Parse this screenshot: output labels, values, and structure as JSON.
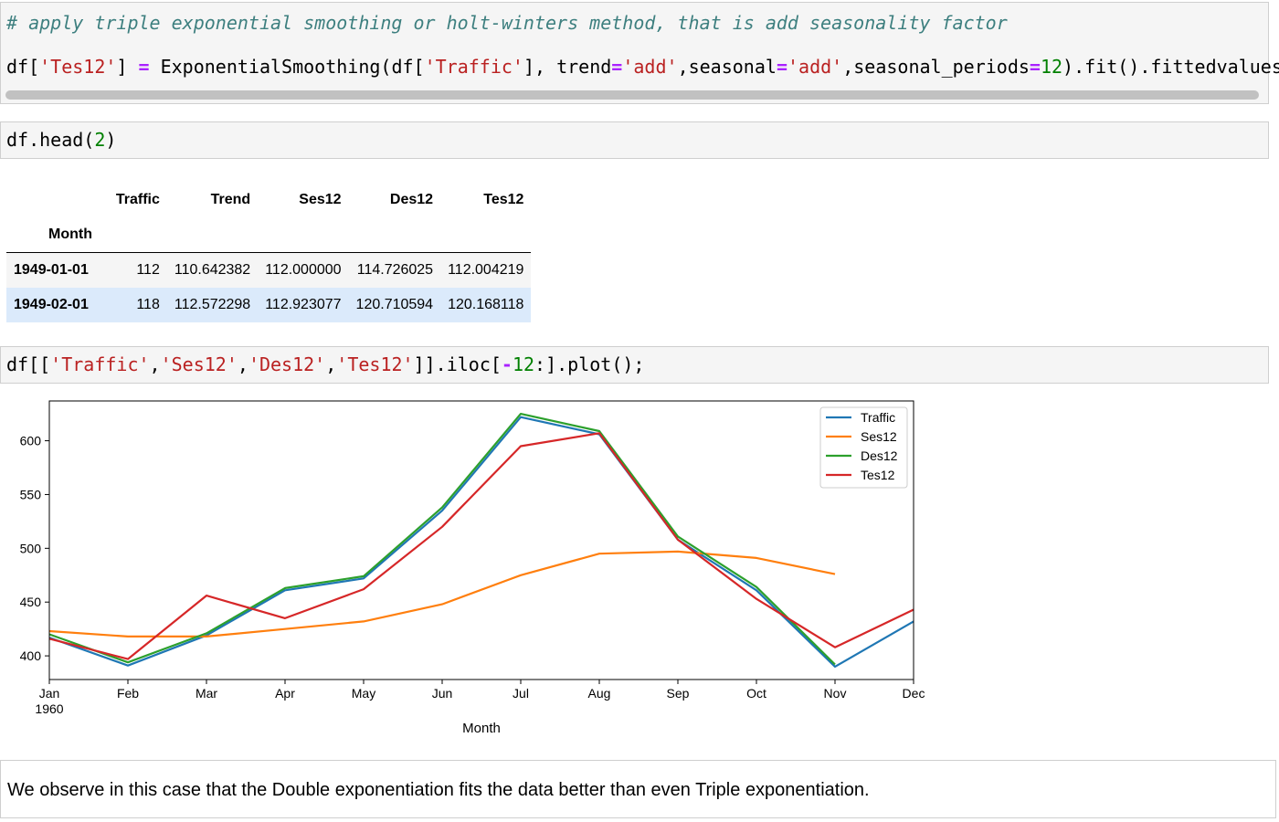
{
  "cells": {
    "code1": {
      "comment": "# apply triple exponential smoothing or holt-winters method, that is add seasonality factor",
      "tokens": [
        {
          "t": "df[",
          "c": ""
        },
        {
          "t": "'Tes12'",
          "c": "st"
        },
        {
          "t": "] ",
          "c": ""
        },
        {
          "t": "=",
          "c": "op"
        },
        {
          "t": " ExponentialSmoothing(df[",
          "c": ""
        },
        {
          "t": "'Traffic'",
          "c": "st"
        },
        {
          "t": "], trend",
          "c": ""
        },
        {
          "t": "=",
          "c": "op"
        },
        {
          "t": "'add'",
          "c": "st"
        },
        {
          "t": ",seasonal",
          "c": ""
        },
        {
          "t": "=",
          "c": "op"
        },
        {
          "t": "'add'",
          "c": "st"
        },
        {
          "t": ",seasonal_periods",
          "c": ""
        },
        {
          "t": "=",
          "c": "op"
        },
        {
          "t": "12",
          "c": "nu"
        },
        {
          "t": ").fit().fittedvalues",
          "c": ""
        }
      ]
    },
    "code2": {
      "tokens": [
        {
          "t": "df.head(",
          "c": ""
        },
        {
          "t": "2",
          "c": "nu"
        },
        {
          "t": ")",
          "c": ""
        }
      ]
    },
    "code3": {
      "tokens": [
        {
          "t": "df[[",
          "c": ""
        },
        {
          "t": "'Traffic'",
          "c": "st"
        },
        {
          "t": ",",
          "c": ""
        },
        {
          "t": "'Ses12'",
          "c": "st"
        },
        {
          "t": ",",
          "c": ""
        },
        {
          "t": "'Des12'",
          "c": "st"
        },
        {
          "t": ",",
          "c": ""
        },
        {
          "t": "'Tes12'",
          "c": "st"
        },
        {
          "t": "]].iloc[",
          "c": ""
        },
        {
          "t": "-",
          "c": "op"
        },
        {
          "t": "12",
          "c": "nu"
        },
        {
          "t": ":].plot();",
          "c": ""
        }
      ]
    },
    "markdown": "We observe in this case that the Double exponentiation fits the data better than even Triple exponentiation."
  },
  "dataframe": {
    "columns": [
      "Traffic",
      "Trend",
      "Ses12",
      "Des12",
      "Tes12"
    ],
    "index_name": "Month",
    "rows": [
      {
        "index": "1949-01-01",
        "values": [
          "112",
          "110.642382",
          "112.000000",
          "114.726025",
          "112.004219"
        ]
      },
      {
        "index": "1949-02-01",
        "values": [
          "118",
          "112.572298",
          "112.923077",
          "120.710594",
          "120.168118"
        ]
      }
    ]
  },
  "chart_data": {
    "type": "line",
    "x": [
      "Jan",
      "Feb",
      "Mar",
      "Apr",
      "May",
      "Jun",
      "Jul",
      "Aug",
      "Sep",
      "Oct",
      "Nov",
      "Dec"
    ],
    "x_sublabel": "1960",
    "xlabel": "Month",
    "ylabel": "",
    "ylim": [
      378,
      637
    ],
    "yticks": [
      400,
      450,
      500,
      550,
      600
    ],
    "grid": false,
    "legend": "top-right",
    "series": [
      {
        "name": "Traffic",
        "color": "#1f77b4",
        "values": [
          417,
          391,
          419,
          461,
          472,
          535,
          622,
          606,
          508,
          461,
          390,
          432
        ]
      },
      {
        "name": "Ses12",
        "color": "#ff7f0e",
        "values": [
          423,
          418,
          418,
          425,
          432,
          448,
          475,
          495,
          497,
          491,
          476,
          null
        ]
      },
      {
        "name": "Des12",
        "color": "#2ca02c",
        "values": [
          420,
          394,
          421,
          463,
          474,
          538,
          625,
          609,
          511,
          464,
          392,
          null
        ]
      },
      {
        "name": "Tes12",
        "color": "#d62728",
        "values": [
          416,
          397,
          456,
          435,
          462,
          520,
          595,
          607,
          508,
          453,
          408,
          443
        ]
      }
    ]
  }
}
